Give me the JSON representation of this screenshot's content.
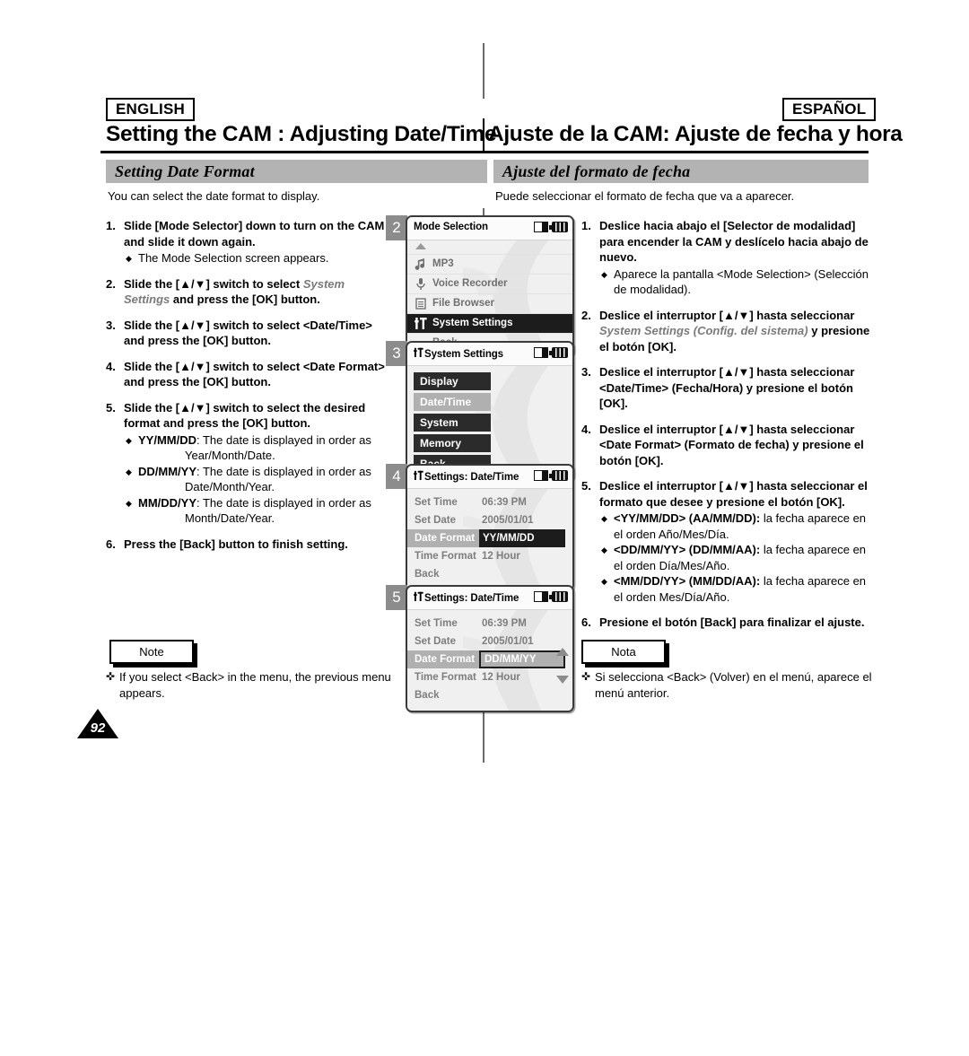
{
  "page": {
    "number": "92"
  },
  "header": {
    "lang_en": "ENGLISH",
    "lang_es": "ESPAÑOL",
    "title_en": "Setting the CAM : Adjusting Date/Time",
    "title_es": "Ajuste de la CAM: Ajuste de fecha y hora",
    "section_en": "Setting Date Format",
    "section_es": "Ajuste del formato de fecha"
  },
  "english": {
    "intro": "You can select the date format to display.",
    "steps": [
      {
        "num": "1.",
        "text_parts": [
          "Slide [Mode Selector] down to turn on the CAM and slide it down again."
        ],
        "bullets": [
          "The Mode Selection screen appears."
        ]
      },
      {
        "num": "2.",
        "pre": "Slide the [▲/▼] switch to select ",
        "italic": "System Settings",
        "post": " and press the [OK] button."
      },
      {
        "num": "3.",
        "plain": "Slide the [▲/▼] switch to select <Date/Time> and press the [OK] button."
      },
      {
        "num": "4.",
        "plain": "Slide the [▲/▼] switch to select <Date Format> and press the [OK] button."
      },
      {
        "num": "5.",
        "plain": "Slide the [▲/▼] switch to select the desired format and press the [OK] button.",
        "formats": [
          {
            "name": "YY/MM/DD",
            "desc": "The date is displayed in order as",
            "order": "Year/Month/Date."
          },
          {
            "name": "DD/MM/YY",
            "desc": "The date is displayed in order as",
            "order": "Date/Month/Year."
          },
          {
            "name": "MM/DD/YY",
            "desc": "The date is displayed in order as",
            "order": "Month/Date/Year."
          }
        ]
      },
      {
        "num": "6.",
        "plain": "Press the [Back] button to finish setting."
      }
    ],
    "note_label": "Note",
    "note_text": "If you select <Back> in the menu, the previous menu appears."
  },
  "spanish": {
    "intro": "Puede seleccionar el formato de fecha que va a aparecer.",
    "steps": [
      {
        "num": "1.",
        "plain": "Deslice hacia abajo el [Selector de modalidad] para encender la CAM y deslícelo hacia abajo de nuevo.",
        "bullets": [
          "Aparece la pantalla <Mode Selection> (Selección de modalidad)."
        ]
      },
      {
        "num": "2.",
        "pre": "Deslice el interruptor [▲/▼] hasta seleccionar ",
        "italic": "System Settings (Config. del sistema)",
        "post": " y presione el botón [OK]."
      },
      {
        "num": "3.",
        "plain": "Deslice el interruptor [▲/▼] hasta seleccionar <Date/Time> (Fecha/Hora) y presione el botón [OK]."
      },
      {
        "num": "4.",
        "plain": "Deslice el interruptor [▲/▼] hasta seleccionar <Date Format> (Formato de fecha) y presione el botón [OK]."
      },
      {
        "num": "5.",
        "plain": "Deslice el interruptor [▲/▼] hasta seleccionar el formato que desee y presione el botón [OK].",
        "formats": [
          {
            "name": "<YY/MM/DD> (AA/MM/DD):",
            "desc": "la fecha aparece en",
            "order": "el orden Año/Mes/Día."
          },
          {
            "name": "<DD/MM/YY> (DD/MM/AA):",
            "desc": "la fecha aparece en",
            "order": "el orden Día/Mes/Año."
          },
          {
            "name": "<MM/DD/YY> (MM/DD/AA):",
            "desc": "la fecha aparece en",
            "order": "el orden Mes/Día/Año."
          }
        ]
      },
      {
        "num": "6.",
        "plain": "Presione el botón [Back] para finalizar el ajuste."
      }
    ],
    "note_label": "Nota",
    "note_text": "Si selecciona <Back> (Volver) en el menú, aparece el menú anterior."
  },
  "screens": [
    {
      "badge": "2",
      "title": "Mode Selection",
      "status_icons": [
        "memory-card-icon",
        "battery-icon"
      ],
      "items": [
        {
          "label": "",
          "icon": "scroll-up-arrow-icon",
          "selected": false
        },
        {
          "label": "MP3",
          "icon": "music-note-icon",
          "selected": false
        },
        {
          "label": "Voice Recorder",
          "icon": "microphone-icon",
          "selected": false
        },
        {
          "label": "File Browser",
          "icon": "file-icon",
          "selected": false
        },
        {
          "label": "System Settings",
          "icon": "settings-tool-icon",
          "selected": true
        },
        {
          "label": "Back",
          "icon": "",
          "selected": false
        }
      ]
    },
    {
      "badge": "3",
      "title": "System Settings",
      "title_icon": "settings-tool-icon",
      "status_icons": [
        "memory-card-icon",
        "battery-icon"
      ],
      "items": [
        {
          "label": "Display",
          "selected": false
        },
        {
          "label": "Date/Time",
          "selected": true
        },
        {
          "label": "System",
          "selected": false
        },
        {
          "label": "Memory",
          "selected": false
        },
        {
          "label": "Back",
          "selected": false
        }
      ]
    },
    {
      "badge": "4",
      "title": "Settings: Date/Time",
      "title_icon": "settings-tool-icon",
      "status_icons": [
        "memory-card-icon",
        "battery-icon"
      ],
      "rows": [
        {
          "label": "Set Time",
          "value": "06:39 PM",
          "selected": false
        },
        {
          "label": "Set Date",
          "value": "2005/01/01",
          "selected": false
        },
        {
          "label": "Date Format",
          "value": "YY/MM/DD",
          "selected": true
        },
        {
          "label": "Time Format",
          "value": "12 Hour",
          "selected": false
        },
        {
          "label": "Back",
          "value": "",
          "selected": false
        }
      ],
      "scroll_arrows": false
    },
    {
      "badge": "5",
      "title": "Settings: Date/Time",
      "title_icon": "settings-tool-icon",
      "status_icons": [
        "memory-card-icon",
        "battery-icon"
      ],
      "rows": [
        {
          "label": "Set Time",
          "value": "06:39 PM",
          "selected": false
        },
        {
          "label": "Set Date",
          "value": "2005/01/01",
          "selected": false
        },
        {
          "label": "Date Format",
          "value": "DD/MM/YY",
          "selected": true,
          "boxed": true
        },
        {
          "label": "Time Format",
          "value": "12 Hour",
          "selected": false
        },
        {
          "label": "Back",
          "value": "",
          "selected": false
        }
      ],
      "scroll_arrows": true
    }
  ]
}
